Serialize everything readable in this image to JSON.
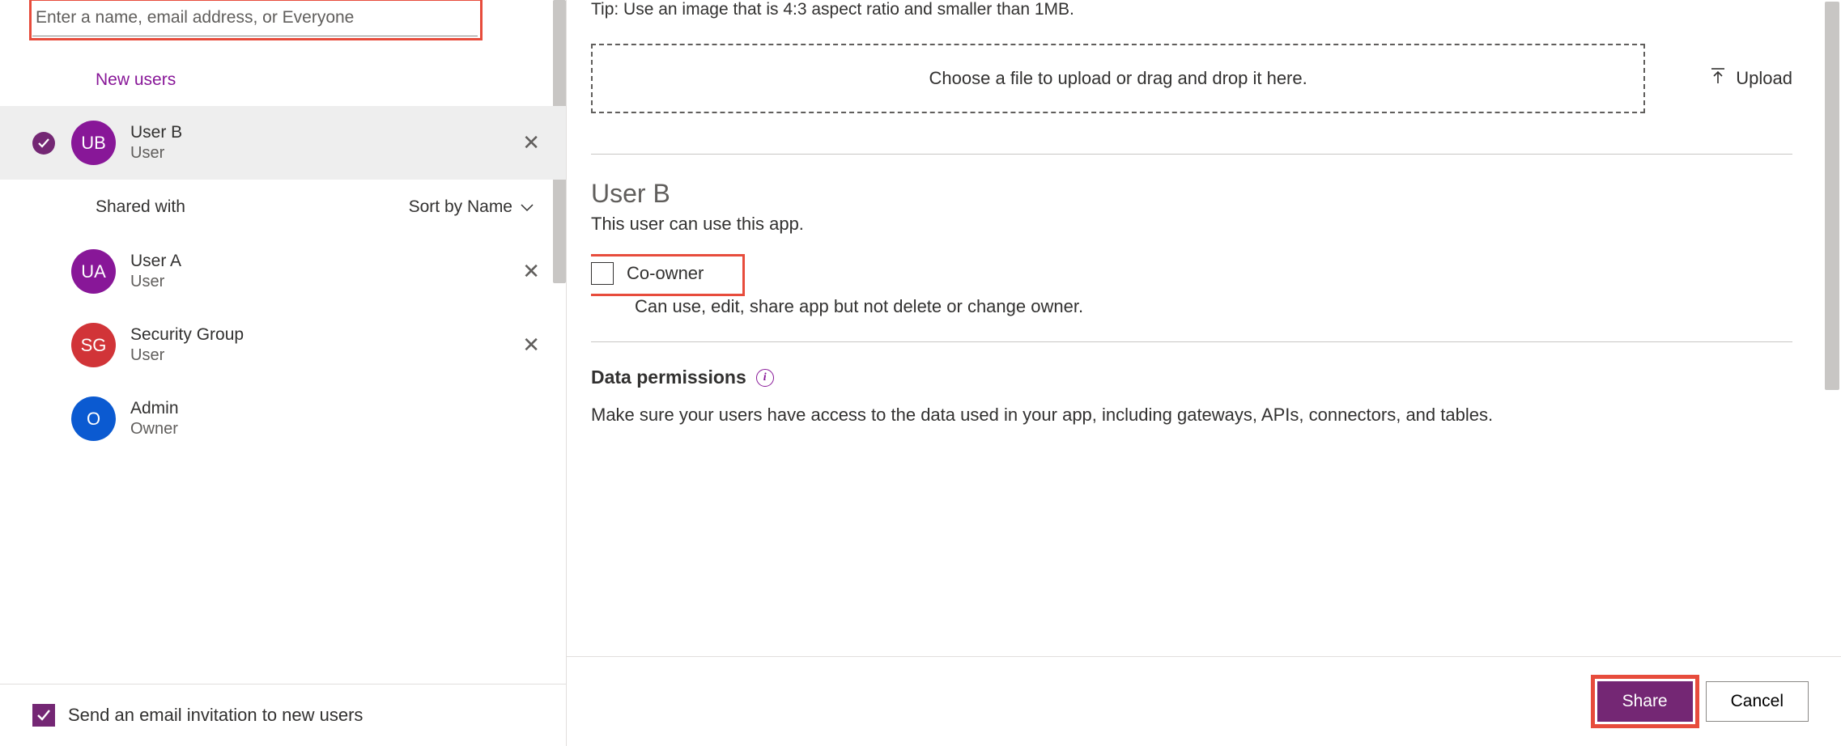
{
  "search": {
    "placeholder": "Enter a name, email address, or Everyone"
  },
  "sections": {
    "new_users": "New users",
    "shared_with": "Shared with",
    "sort_by": "Sort by Name"
  },
  "users": {
    "selected": {
      "initials": "UB",
      "name": "User B",
      "role": "User"
    },
    "shared": [
      {
        "initials": "UA",
        "name": "User A",
        "role": "User",
        "color": "purple",
        "removable": true
      },
      {
        "initials": "SG",
        "name": "Security Group",
        "role": "User",
        "color": "red",
        "removable": true
      },
      {
        "initials": "O",
        "name": "Admin",
        "role": "Owner",
        "color": "blue",
        "removable": false
      }
    ]
  },
  "footer_left": {
    "send_email": "Send an email invitation to new users"
  },
  "right": {
    "tip": "Tip: Use an image that is 4:3 aspect ratio and smaller than 1MB.",
    "dropzone": "Choose a file to upload or drag and drop it here.",
    "upload": "Upload",
    "user_title": "User B",
    "user_desc": "This user can use this app.",
    "coowner_label": "Co-owner",
    "coowner_desc": "Can use, edit, share app but not delete or change owner.",
    "perm_title": "Data permissions",
    "perm_desc": "Make sure your users have access to the data used in your app, including gateways, APIs, connectors, and tables."
  },
  "buttons": {
    "share": "Share",
    "cancel": "Cancel"
  }
}
